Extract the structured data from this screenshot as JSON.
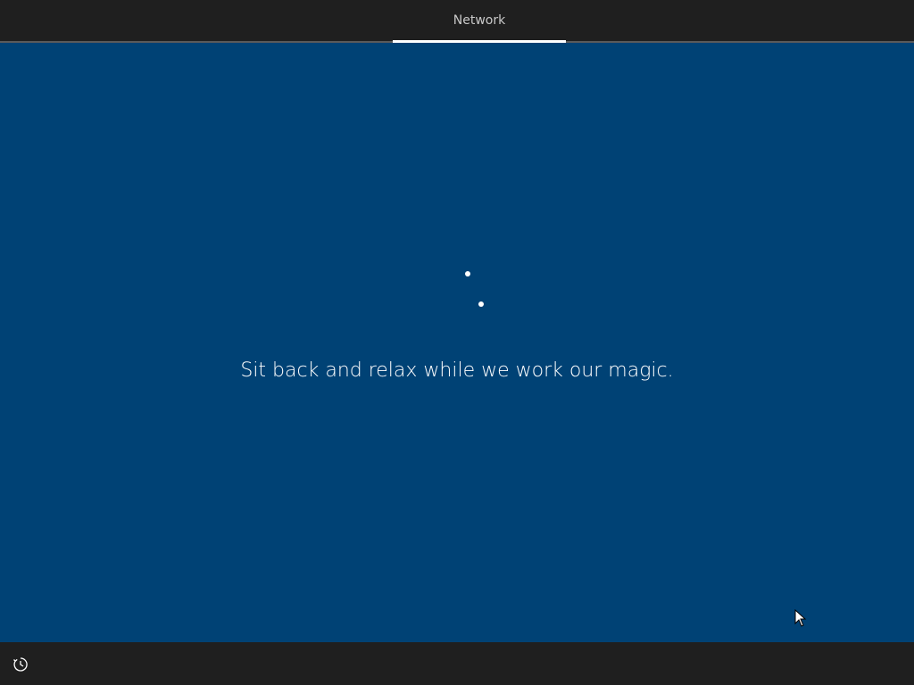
{
  "header": {
    "active_tab": "Network"
  },
  "main": {
    "message": "Sit back and relax while we work our magic."
  },
  "footer": {
    "ease_of_access_icon": "ease-of-access-icon"
  },
  "colors": {
    "background": "#004275",
    "bar": "#1f1f1f",
    "text": "#ffffff",
    "tab_text": "#c9c9c9"
  }
}
